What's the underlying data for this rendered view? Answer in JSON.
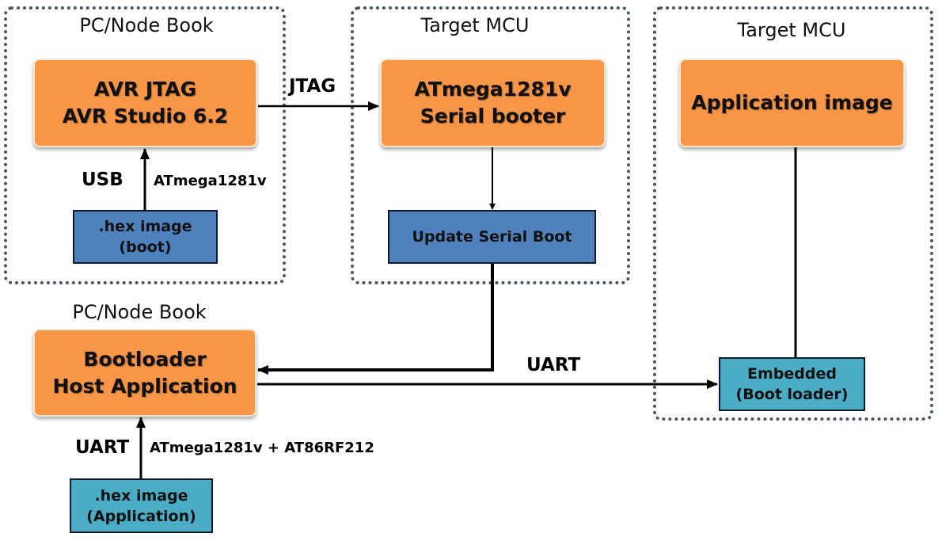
{
  "groups": {
    "pc_top": {
      "title": "PC/Node Book"
    },
    "mcu_middle": {
      "title": "Target MCU"
    },
    "mcu_right": {
      "title": "Target MCU"
    },
    "pc_bottom": {
      "title": "PC/Node Book"
    }
  },
  "nodes": {
    "avr_jtag": {
      "line1": "AVR JTAG",
      "line2": "AVR Studio 6.2"
    },
    "hex_boot": {
      "line1": ".hex image",
      "line2": "(boot)"
    },
    "serial_booter": {
      "line1": "ATmega1281v",
      "line2": "Serial booter"
    },
    "update_serial_boot": {
      "line1": "Update Serial Boot"
    },
    "application_image": {
      "line1": "Application image"
    },
    "embedded_bootloader": {
      "line1": "Embedded",
      "line2": "(Boot loader)"
    },
    "bootloader_host": {
      "line1": "Bootloader",
      "line2": "Host Application"
    },
    "hex_application": {
      "line1": ".hex image",
      "line2": "(Application)"
    }
  },
  "edges": {
    "jtag": "JTAG",
    "usb": "USB",
    "usb_device": "ATmega1281v",
    "uart_main": "UART",
    "uart_bottom": "UART",
    "uart_bottom_device": "ATmega1281v + AT86RF212"
  },
  "colors": {
    "orange": "#f79646",
    "blue": "#4f81bd",
    "cyan": "#4bacc6",
    "dotted_border": "#44546a"
  }
}
